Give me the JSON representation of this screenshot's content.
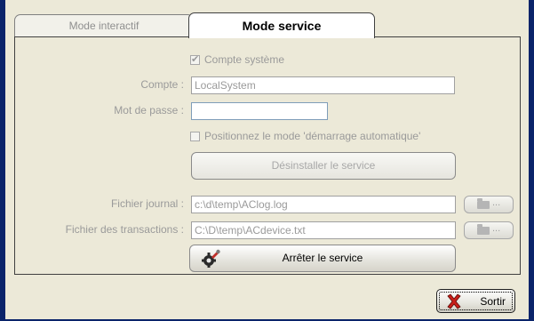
{
  "tabs": [
    {
      "label": "Mode interactif"
    },
    {
      "label": "Mode service"
    }
  ],
  "service": {
    "system_account_label": "Compte système",
    "system_account_checked": true,
    "account_label": "Compte :",
    "account_value": "LocalSystem",
    "password_label": "Mot de passe :",
    "password_value": "",
    "auto_start_label": "Positionnez le mode 'démarrage automatique'",
    "auto_start_checked": false,
    "uninstall_label": "Désinstaller le service",
    "log_file_label": "Fichier journal :",
    "log_file_value": "c:\\d\\temp\\AClog.log",
    "transactions_file_label": "Fichier des transactions :",
    "transactions_file_value": "C:\\D\\temp\\ACdevice.txt",
    "browse_label": "...",
    "stop_label": "Arrêter le service"
  },
  "footer": {
    "exit_label": "Sortir"
  },
  "icons": {
    "checkmark": "check-icon",
    "folder": "folder-icon",
    "stop": "gear-wrench-icon",
    "exit": "red-x-icon"
  },
  "colors": {
    "frame": "#0a246a",
    "background": "#ece9d8",
    "disabled_text": "#9a9a9a"
  }
}
